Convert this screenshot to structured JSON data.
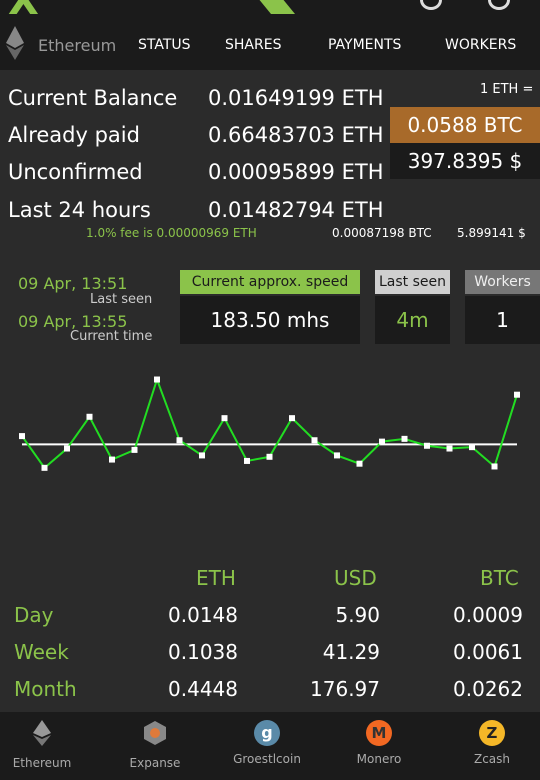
{
  "nav": {
    "coin": "Ethereum",
    "items": [
      "STATUS",
      "SHARES",
      "PAYMENTS",
      "WORKERS"
    ]
  },
  "balances": {
    "rows": [
      {
        "label": "Current Balance",
        "value": "0.01649199 ETH"
      },
      {
        "label": "Already paid",
        "value": "0.66483703 ETH"
      },
      {
        "label": "Unconfirmed",
        "value": "0.00095899 ETH"
      },
      {
        "label": "Last 24 hours",
        "value": "0.01482794 ETH"
      }
    ],
    "fee_note": "1.0% fee is 0.00000969 ETH",
    "btc_24h": "0.00087198 BTC",
    "usd_24h": "5.899141 $"
  },
  "rate": {
    "header": "1 ETH =",
    "btc": "0.0588 BTC",
    "usd": "397.8395 $"
  },
  "times": {
    "last_seen_time": "09 Apr, 13:51",
    "last_seen_label": "Last seen",
    "current_time": "09 Apr, 13:55",
    "current_time_label": "Current time"
  },
  "stats": {
    "speed_label": "Current approx. speed",
    "speed_value": "183.50 mhs",
    "last_seen_label": "Last seen",
    "last_seen_value": "4m",
    "workers_label": "Workers",
    "workers_value": "1"
  },
  "chart_data": {
    "type": "line",
    "values": [
      55,
      32,
      46,
      69,
      38,
      45,
      96,
      52,
      41,
      68,
      37,
      40,
      68,
      52,
      41,
      35,
      51,
      53,
      48,
      46,
      47,
      33,
      85
    ],
    "baseline": 49,
    "color": "#22dd22",
    "baseline_color": "#ffffff"
  },
  "earnings": {
    "headers": [
      "ETH",
      "USD",
      "BTC"
    ],
    "rows": [
      {
        "label": "Day",
        "eth": "0.0148",
        "usd": "5.90",
        "btc": "0.0009"
      },
      {
        "label": "Week",
        "eth": "0.1038",
        "usd": "41.29",
        "btc": "0.0061"
      },
      {
        "label": "Month",
        "eth": "0.4448",
        "usd": "176.97",
        "btc": "0.0262"
      }
    ]
  },
  "bottom_nav": [
    {
      "label": "Ethereum",
      "icon": "ethereum-icon"
    },
    {
      "label": "Expanse",
      "icon": "expanse-icon"
    },
    {
      "label": "Groestlcoin",
      "icon": "groestlcoin-icon"
    },
    {
      "label": "Monero",
      "icon": "monero-icon"
    },
    {
      "label": "Zcash",
      "icon": "zcash-icon"
    }
  ],
  "colors": {
    "accent_green": "#8bc34a",
    "btc_orange": "#a86a2a",
    "panel": "#1b1b1b",
    "background": "#2b2b2b"
  }
}
